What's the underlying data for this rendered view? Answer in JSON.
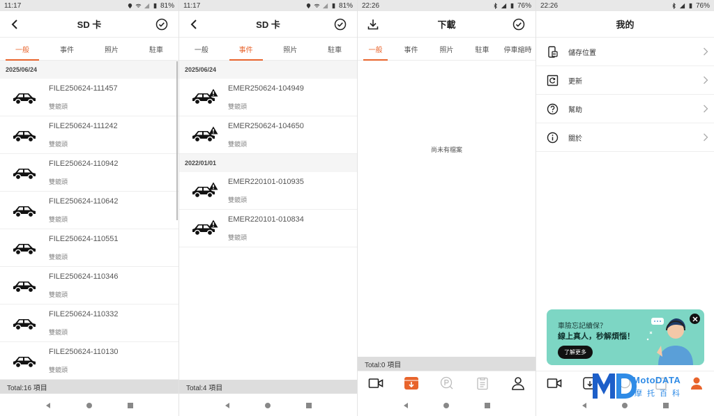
{
  "colors": {
    "accent": "#e8642c",
    "promo_bg": "#7dd6c4",
    "watermark": "#2f8be6"
  },
  "panel1": {
    "status": {
      "time": "11:17",
      "battery": "81%"
    },
    "header": {
      "title": "SD 卡"
    },
    "tabs": [
      {
        "label": "一般",
        "active": true
      },
      {
        "label": "事件",
        "active": false
      },
      {
        "label": "照片",
        "active": false
      },
      {
        "label": "駐車",
        "active": false
      }
    ],
    "section_date": "2025/06/24",
    "items": [
      {
        "name": "FILE250624-111457",
        "sub": "雙鏡頭",
        "icon": "car-icon"
      },
      {
        "name": "FILE250624-111242",
        "sub": "雙鏡頭",
        "icon": "car-icon"
      },
      {
        "name": "FILE250624-110942",
        "sub": "雙鏡頭",
        "icon": "car-icon"
      },
      {
        "name": "FILE250624-110642",
        "sub": "雙鏡頭",
        "icon": "car-icon"
      },
      {
        "name": "FILE250624-110551",
        "sub": "雙鏡頭",
        "icon": "car-icon"
      },
      {
        "name": "FILE250624-110346",
        "sub": "雙鏡頭",
        "icon": "car-icon"
      },
      {
        "name": "FILE250624-110332",
        "sub": "雙鏡頭",
        "icon": "car-icon"
      },
      {
        "name": "FILE250624-110130",
        "sub": "雙鏡頭",
        "icon": "car-icon"
      }
    ],
    "footer": "Total:16 項目"
  },
  "panel2": {
    "status": {
      "time": "11:17",
      "battery": "81%"
    },
    "header": {
      "title": "SD 卡"
    },
    "tabs": [
      {
        "label": "一般",
        "active": false
      },
      {
        "label": "事件",
        "active": true
      },
      {
        "label": "照片",
        "active": false
      },
      {
        "label": "駐車",
        "active": false
      }
    ],
    "sections": [
      {
        "date": "2025/06/24",
        "items": [
          {
            "name": "EMER250624-104949",
            "sub": "雙鏡頭"
          },
          {
            "name": "EMER250624-104650",
            "sub": "雙鏡頭"
          }
        ]
      },
      {
        "date": "2022/01/01",
        "items": [
          {
            "name": "EMER220101-010935",
            "sub": "雙鏡頭"
          },
          {
            "name": "EMER220101-010834",
            "sub": "雙鏡頭"
          }
        ]
      }
    ],
    "footer": "Total:4 項目"
  },
  "panel3": {
    "status": {
      "time": "22:26",
      "battery": "76%"
    },
    "header": {
      "title": "下載"
    },
    "tabs": [
      {
        "label": "一般",
        "active": true
      },
      {
        "label": "事件",
        "active": false
      },
      {
        "label": "照片",
        "active": false
      },
      {
        "label": "駐車",
        "active": false
      },
      {
        "label": "停車縮時",
        "active": false
      }
    ],
    "empty_text": "尚未有檔案",
    "footer": "Total:0 項目",
    "bottom_nav": [
      "video-icon",
      "download-icon",
      "parking-icon",
      "clipboard-icon",
      "person-icon"
    ]
  },
  "panel4": {
    "status": {
      "time": "22:26",
      "battery": "76%"
    },
    "header": {
      "title": "我的"
    },
    "menu": [
      {
        "label": "儲存位置",
        "icon": "storage-icon"
      },
      {
        "label": "更新",
        "icon": "update-icon"
      },
      {
        "label": "幫助",
        "icon": "help-icon"
      },
      {
        "label": "關於",
        "icon": "info-icon"
      }
    ],
    "promo": {
      "line1": "車險忘記續保？",
      "line2": "線上真人，秒解煩惱！",
      "button": "了解更多"
    },
    "watermark": {
      "en": "MotoDATA",
      "zh": "摩托百科"
    }
  }
}
